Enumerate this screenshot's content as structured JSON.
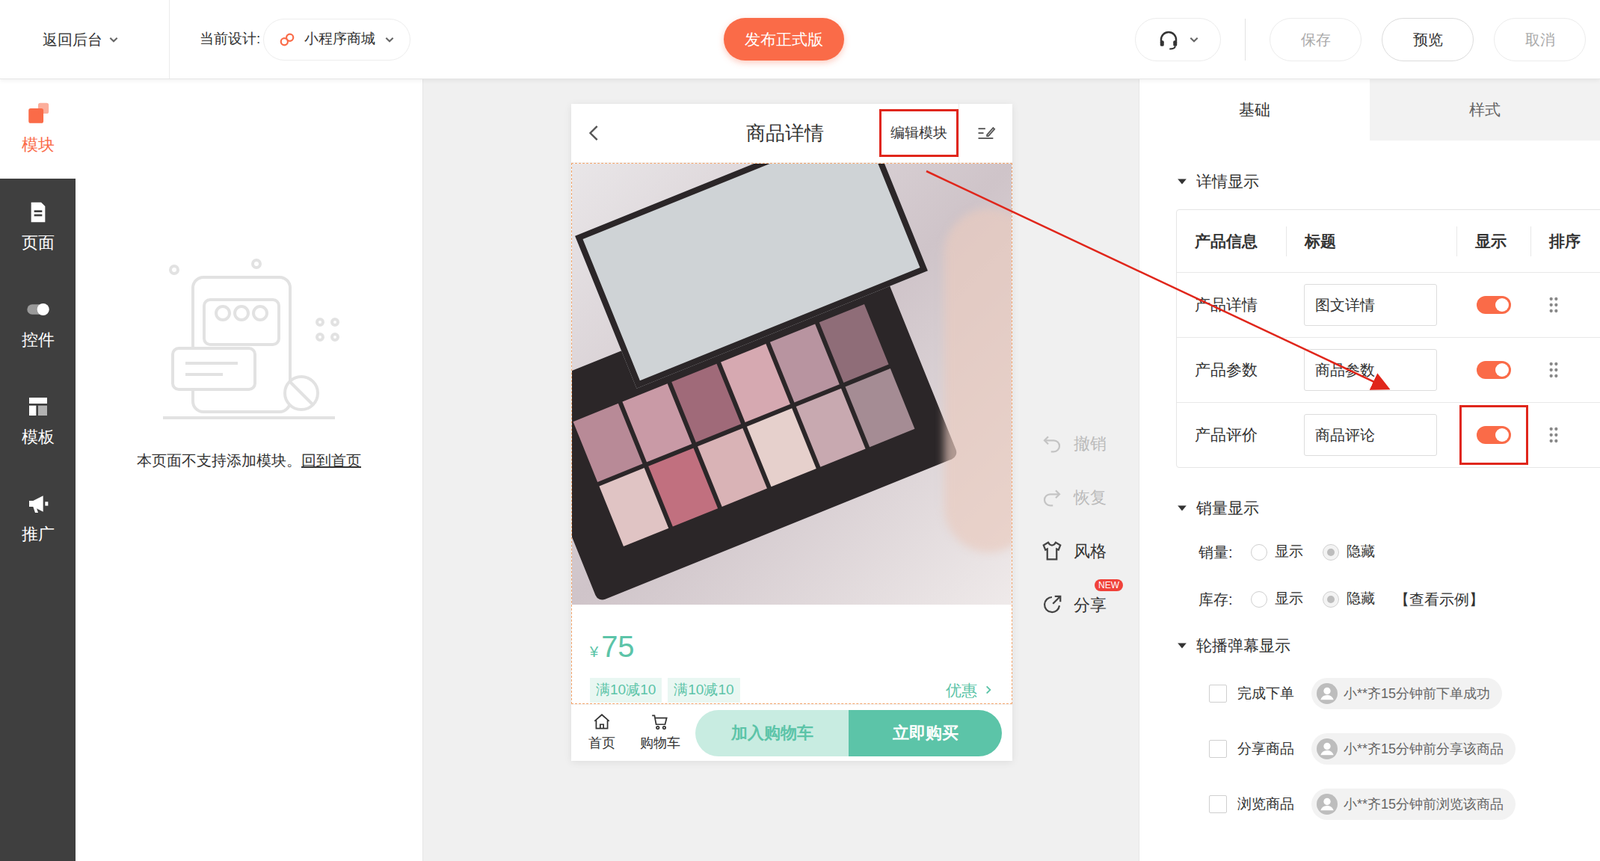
{
  "topbar": {
    "back": "返回后台",
    "design_label": "当前设计:",
    "design": "小程序商城",
    "publish": "发布正式版",
    "buttons": [
      {
        "label": "保存",
        "disabled": true
      },
      {
        "label": "预览",
        "disabled": false
      },
      {
        "label": "取消",
        "disabled": true
      }
    ]
  },
  "sidebar": {
    "items": [
      {
        "label": "模块",
        "selected": true
      },
      {
        "label": "页面",
        "selected": false
      },
      {
        "label": "控件",
        "selected": false
      },
      {
        "label": "模板",
        "selected": false
      },
      {
        "label": "推广",
        "selected": false
      }
    ]
  },
  "left_panel": {
    "message": "本页面不支持添加模块。",
    "link": "回到首页"
  },
  "phone": {
    "title": "商品详情",
    "edit_button": "编辑模块",
    "edit_highlighted": true,
    "price_symbol": "¥",
    "price": "75",
    "tags": [
      "满10减10",
      "满10减10"
    ],
    "coupon": "优惠",
    "nav": [
      {
        "label": "首页"
      },
      {
        "label": "购物车"
      }
    ],
    "add_cart": "加入购物车",
    "buy": "立即购买"
  },
  "tools": [
    {
      "label": "撤销",
      "disabled": true,
      "badge": ""
    },
    {
      "label": "恢复",
      "disabled": true,
      "badge": ""
    },
    {
      "label": "风格",
      "disabled": false,
      "badge": ""
    },
    {
      "label": "分享",
      "disabled": false,
      "badge": "NEW"
    }
  ],
  "panel": {
    "tabs": [
      {
        "label": "基础",
        "selected": true
      },
      {
        "label": "样式",
        "selected": false
      }
    ],
    "detail_section": {
      "title": "详情显示",
      "expanded": true,
      "columns": [
        "产品信息",
        "标题",
        "显示",
        "排序"
      ],
      "rows": [
        {
          "name": "产品详情",
          "title": "图文详情",
          "on": true,
          "highlighted": false
        },
        {
          "name": "产品参数",
          "title": "商品参数",
          "on": true,
          "highlighted": false
        },
        {
          "name": "产品评价",
          "title": "商品评论",
          "on": true,
          "highlighted": true
        }
      ]
    },
    "sales_section": {
      "title": "销量显示",
      "expanded": true,
      "rows": [
        {
          "label": "销量:",
          "options": [
            {
              "label": "显示",
              "selected": false
            },
            {
              "label": "隐藏",
              "selected": true
            }
          ],
          "link": ""
        },
        {
          "label": "库存:",
          "options": [
            {
              "label": "显示",
              "selected": false
            },
            {
              "label": "隐藏",
              "selected": true
            }
          ],
          "link": "【查看示例】"
        }
      ]
    },
    "barrage_section": {
      "title": "轮播弹幕显示",
      "expanded": true,
      "items": [
        {
          "label": "完成下单",
          "checked": false,
          "preview": "小**齐15分钟前下单成功"
        },
        {
          "label": "分享商品",
          "checked": false,
          "preview": "小**齐15分钟前分享该商品"
        },
        {
          "label": "浏览商品",
          "checked": false,
          "preview": "小**齐15分钟前浏览该商品"
        }
      ]
    }
  }
}
